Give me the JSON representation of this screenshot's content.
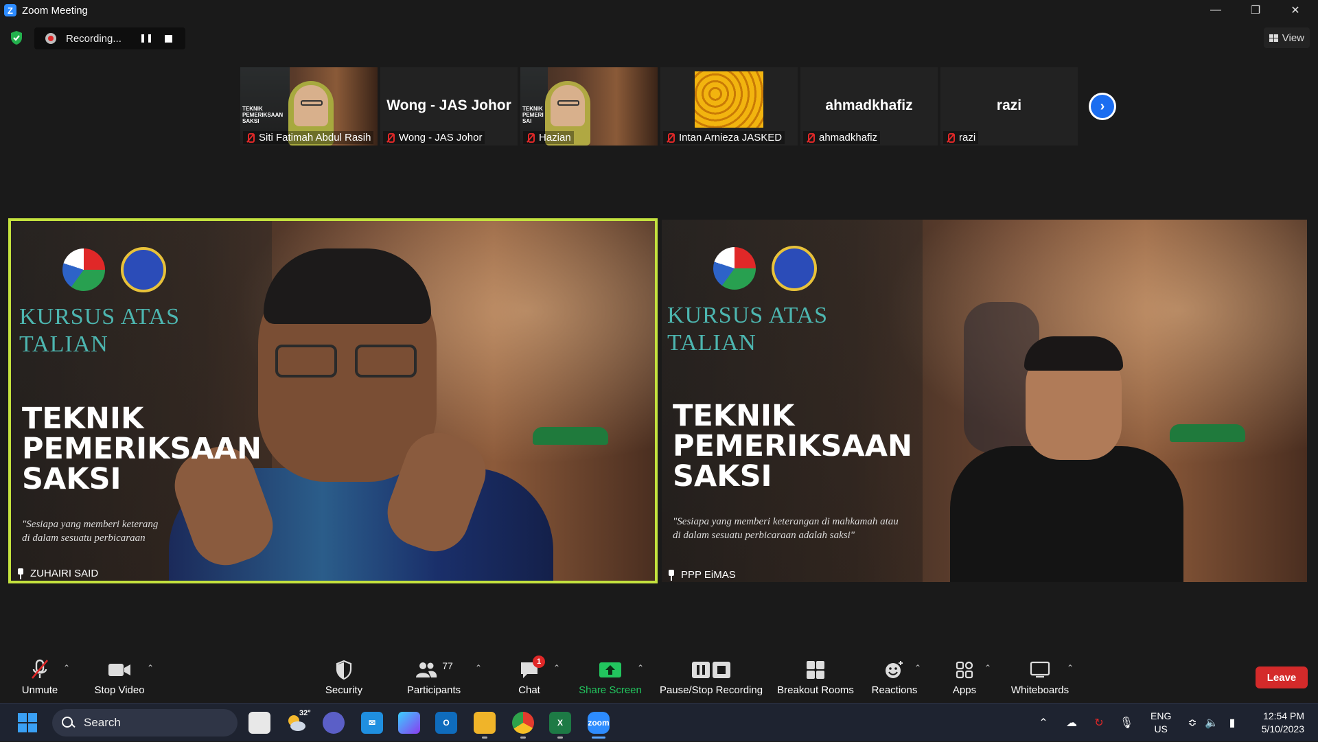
{
  "window": {
    "title": "Zoom Meeting",
    "app_icon": "Z"
  },
  "topbar": {
    "recording_label": "Recording...",
    "view_label": "View"
  },
  "thumbnails": [
    {
      "name": "Siti Fatimah Abdul Rasih",
      "type": "video",
      "slide_text": "TEKNIK PEMERIKSAAN SAKSI",
      "muted": true
    },
    {
      "name": "Wong - JAS Johor",
      "type": "name",
      "display": "Wong - JAS Johor",
      "muted": true
    },
    {
      "name": "Hazian",
      "type": "video",
      "slide_text": "TEKNIK PEMERI SAI",
      "muted": true
    },
    {
      "name": "Intan Arnieza JASKED",
      "type": "image",
      "muted": true
    },
    {
      "name": "ahmadkhafiz",
      "type": "name",
      "display": "ahmadkhafiz",
      "muted": true
    },
    {
      "name": "razi",
      "type": "name",
      "display": "razi",
      "muted": true
    }
  ],
  "main_videos": [
    {
      "name": "ZUHAIRI SAID",
      "kursus_line1": "KURSUS ATAS",
      "kursus_line2": "TALIAN",
      "teknik_line1": "TEKNIK",
      "teknik_line2": "PEMERIKSAAN",
      "teknik_line3": "SAKSI",
      "quote_line1": "\"Sesiapa yang memberi keterang",
      "quote_line2": "di dalam sesuatu perbicaraan",
      "active_speaker": true
    },
    {
      "name": "PPP EiMAS",
      "kursus_line1": "KURSUS ATAS",
      "kursus_line2": "TALIAN",
      "teknik_line1": "TEKNIK",
      "teknik_line2": "PEMERIKSAAN",
      "teknik_line3": "SAKSI",
      "quote_line1": "\"Sesiapa yang memberi keterangan di mahkamah atau",
      "quote_line2": "di dalam sesuatu perbicaraan adalah saksi\"",
      "active_speaker": false
    }
  ],
  "toolbar": {
    "unmute": "Unmute",
    "stop_video": "Stop Video",
    "security": "Security",
    "participants": "Participants",
    "participants_count": "77",
    "chat": "Chat",
    "chat_badge": "1",
    "share_screen": "Share Screen",
    "pause_stop_recording": "Pause/Stop Recording",
    "breakout_rooms": "Breakout Rooms",
    "reactions": "Reactions",
    "apps": "Apps",
    "whiteboards": "Whiteboards",
    "leave": "Leave",
    "share_color": "#22c55e",
    "leave_color": "#d42a2a",
    "active_speaker_border": "#c4e23e"
  },
  "taskbar": {
    "search_label": "Search",
    "weather_temp": "32°",
    "apps": [
      "file-explorer-icon",
      "weather-icon",
      "teams-icon",
      "mail-icon",
      "copilot-icon",
      "outlook-icon",
      "folder-icon",
      "chrome-icon",
      "excel-icon",
      "zoom-icon"
    ],
    "lang_line1": "ENG",
    "lang_line2": "US",
    "time": "12:54 PM",
    "date": "5/10/2023"
  }
}
